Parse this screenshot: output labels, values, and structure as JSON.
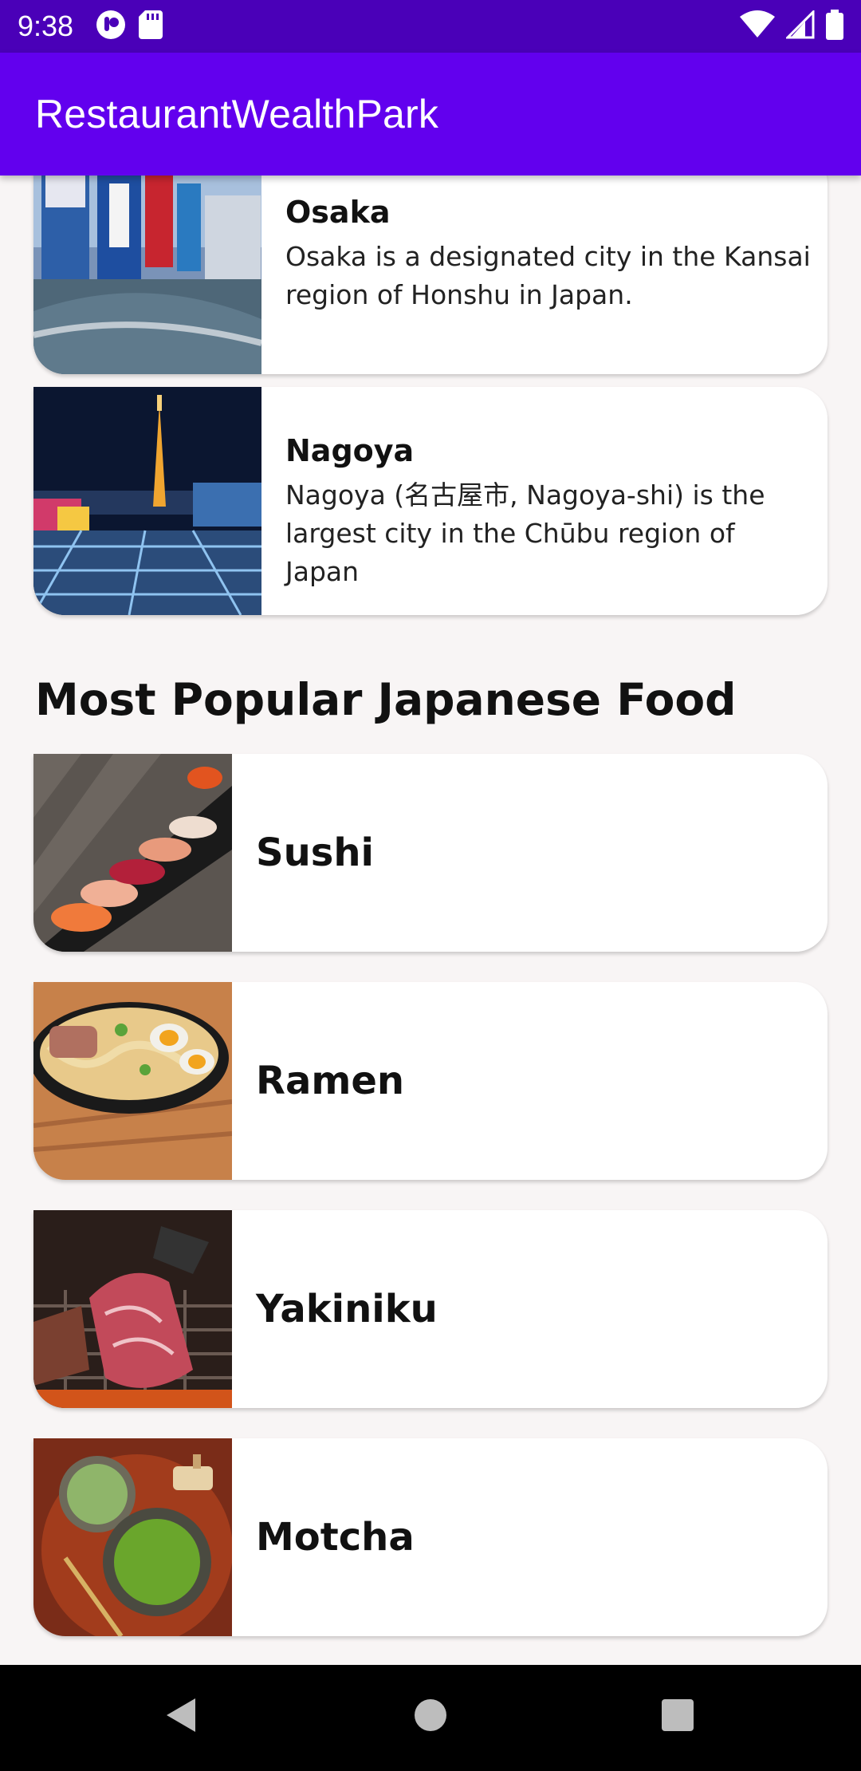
{
  "status_bar": {
    "time": "9:38"
  },
  "app_bar": {
    "title": "RestaurantWealthPark"
  },
  "cities": [
    {
      "name": "Osaka",
      "description": "Osaka is a designated city in the Kansai region of Honshu in Japan."
    },
    {
      "name": "Nagoya",
      "description": "Nagoya (名古屋市, Nagoya-shi) is the largest city in the Chūbu region of Japan"
    }
  ],
  "section": {
    "title": "Most Popular Japanese Food"
  },
  "foods": [
    {
      "name": "Sushi"
    },
    {
      "name": "Ramen"
    },
    {
      "name": "Yakiniku"
    },
    {
      "name": "Motcha"
    }
  ],
  "colors": {
    "status_bar": "#4a00b8",
    "app_bar": "#6200ee",
    "background": "#f8f5f5"
  }
}
